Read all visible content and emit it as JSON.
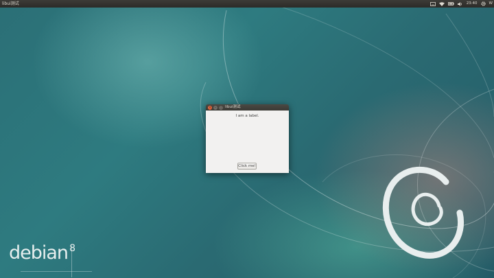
{
  "panel": {
    "app_title": "libui测试",
    "clock": "23:40",
    "user": "W"
  },
  "window": {
    "title": "libui测试",
    "label": "I am a label.",
    "button": "Click me!"
  },
  "desktop": {
    "logo_word": "debian",
    "logo_version": "8"
  },
  "colors": {
    "panel_bg": "#2c2b28",
    "close_button": "#d0461d",
    "window_bg": "#f2f1f0",
    "desktop_teal": "#2b6f76"
  },
  "icons": [
    "keyboard-icon",
    "wifi-icon",
    "battery-icon",
    "volume-icon",
    "gear-icon"
  ]
}
